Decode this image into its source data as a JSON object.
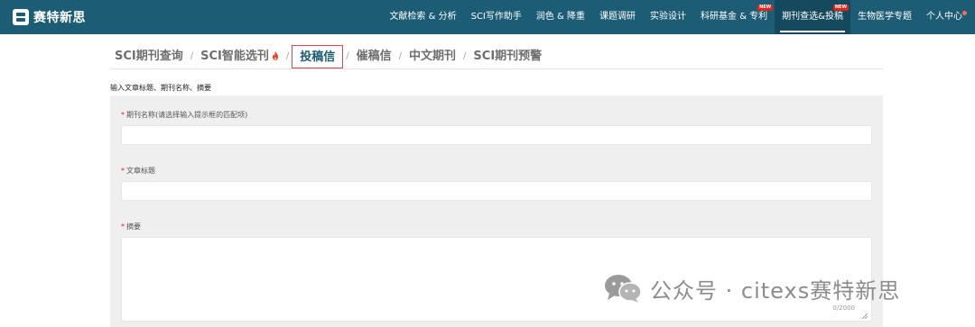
{
  "logo": {
    "text": "赛特新思",
    "icon": "logo-mark"
  },
  "nav": {
    "items": [
      {
        "label": "文献检索 & 分析"
      },
      {
        "label": "SCI写作助手"
      },
      {
        "label": "润色 & 降重"
      },
      {
        "label": "课题调研"
      },
      {
        "label": "实验设计"
      },
      {
        "label": "科研基金 & 专利",
        "badge": "NEW"
      },
      {
        "label": "期刊查选&投稿",
        "badge": "NEW",
        "active": true
      },
      {
        "label": "生物医学专题"
      },
      {
        "label": "个人中心",
        "dot": true
      }
    ]
  },
  "tabs": [
    {
      "label": "SCI期刊查询"
    },
    {
      "label": "SCI智能选刊",
      "icon": "fire-icon"
    },
    {
      "label": "投稿信",
      "active": true
    },
    {
      "label": "催稿信"
    },
    {
      "label": "中文期刊"
    },
    {
      "label": "SCI期刊预警"
    }
  ],
  "tab_separator": "/",
  "hint": "输入文章标题、期刊名称、摘要",
  "form": {
    "required_mark": "*",
    "journal_label": "期刊名称(请选择输入提示框的匹配项)",
    "title_label": "文章标题",
    "abstract_label": "摘要",
    "abstract_counter": "0/2000"
  },
  "watermark": {
    "text": "公众号 · citexs赛特新思",
    "icon": "wechat-icon"
  },
  "colors": {
    "nav_bg": "#1c5c74",
    "active_tab_border": "#e0474c",
    "required": "#e2231a",
    "badge": "#e2231a"
  }
}
